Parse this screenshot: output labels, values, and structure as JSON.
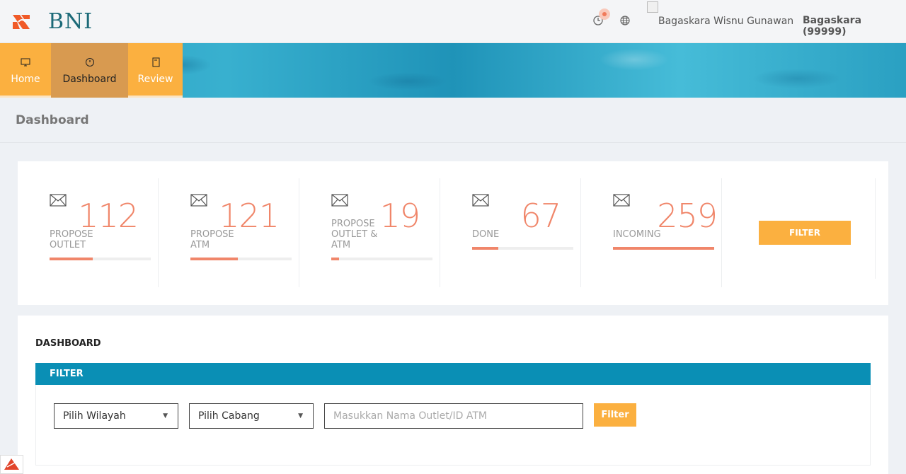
{
  "brand": {
    "name": "BNI",
    "accent": "#f05a28",
    "primary": "#1c6a78"
  },
  "header": {
    "icons": [
      "clock-icon",
      "globe-icon"
    ],
    "user_image_alt": "Bagaskara Wisnu Gunawan",
    "user_id": "Bagaskara (99999)"
  },
  "nav": {
    "items": [
      {
        "label": "Home",
        "icon": "monitor-icon"
      },
      {
        "label": "Dashboard",
        "icon": "speedometer-icon",
        "active": true
      },
      {
        "label": "Review",
        "icon": "book-icon"
      }
    ]
  },
  "page": {
    "title": "Dashboard"
  },
  "stats": [
    {
      "label_lines": [
        "PROPOSE",
        "OUTLET"
      ],
      "value": "112",
      "progress": 0.43
    },
    {
      "label_lines": [
        "PROPOSE",
        "ATM"
      ],
      "value": "121",
      "progress": 0.47
    },
    {
      "label_lines": [
        "PROPOSE",
        "OUTLET &",
        "ATM"
      ],
      "value": "19",
      "progress": 0.08
    },
    {
      "label_lines": [
        "DONE"
      ],
      "value": "67",
      "progress": 0.26
    },
    {
      "label_lines": [
        "INCOMING"
      ],
      "value": "259",
      "progress": 1.0
    }
  ],
  "stats_filter_button": "FILTER",
  "dashboard": {
    "title": "DASHBOARD",
    "filter_header": "FILTER",
    "region_select": "Pilih Wilayah",
    "branch_select": "Pilih Cabang",
    "search_placeholder": "Masukkan Nama Outlet/ID ATM",
    "filter_button": "Filter"
  },
  "colors": {
    "orange": "#fbb040",
    "salmon": "#f0866a",
    "teal": "#0a8fb5"
  }
}
